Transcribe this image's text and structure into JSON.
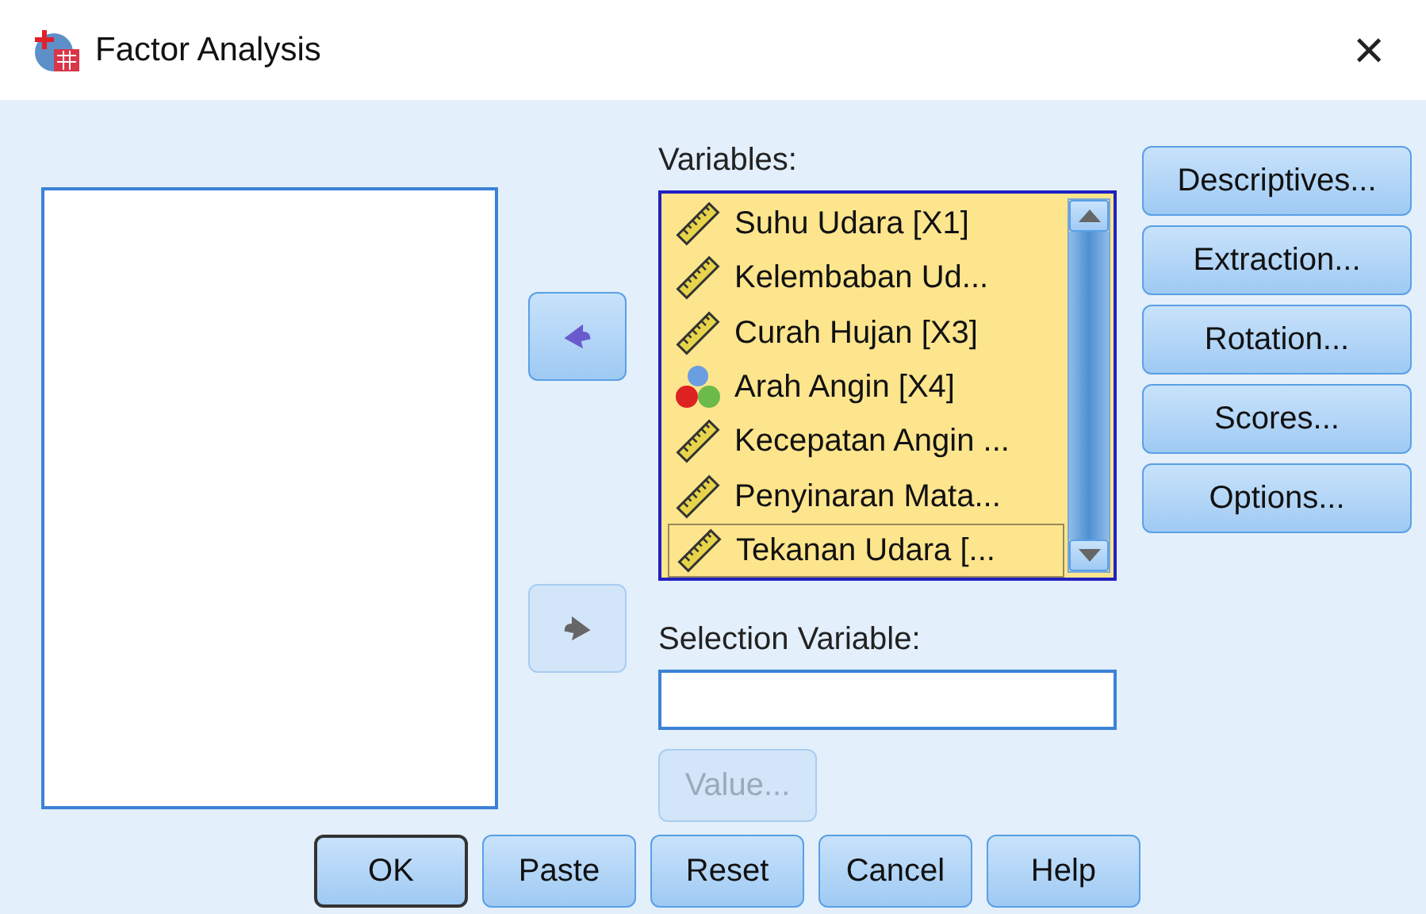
{
  "window": {
    "title": "Factor Analysis",
    "close": "×"
  },
  "variables": {
    "label": "Variables:",
    "items": [
      {
        "name": "Suhu Udara [X1]",
        "kind": "scale",
        "focused": false
      },
      {
        "name": "Kelembaban Ud...",
        "kind": "scale",
        "focused": false
      },
      {
        "name": "Curah Hujan [X3]",
        "kind": "scale",
        "focused": false
      },
      {
        "name": "Arah Angin [X4]",
        "kind": "nominal",
        "focused": false
      },
      {
        "name": "Kecepatan Angin ...",
        "kind": "scale",
        "focused": false
      },
      {
        "name": "Penyinaran Mata...",
        "kind": "scale",
        "focused": false
      },
      {
        "name": "Tekanan Udara [...",
        "kind": "scale",
        "focused": true
      }
    ]
  },
  "move_buttons": [
    {
      "kind": "left",
      "disabled": false
    },
    {
      "kind": "right",
      "disabled": true
    }
  ],
  "selection": {
    "label": "Selection Variable:",
    "value_button": {
      "label": "Value...",
      "disabled": true
    }
  },
  "side_buttons": [
    {
      "label": "Descriptives..."
    },
    {
      "label": "Extraction..."
    },
    {
      "label": "Rotation..."
    },
    {
      "label": "Scores..."
    },
    {
      "label": "Options..."
    }
  ],
  "bottom_buttons": [
    {
      "label": "OK",
      "default": true
    },
    {
      "label": "Paste",
      "default": false
    },
    {
      "label": "Reset",
      "default": false
    },
    {
      "label": "Cancel",
      "default": false
    },
    {
      "label": "Help",
      "default": false
    }
  ]
}
